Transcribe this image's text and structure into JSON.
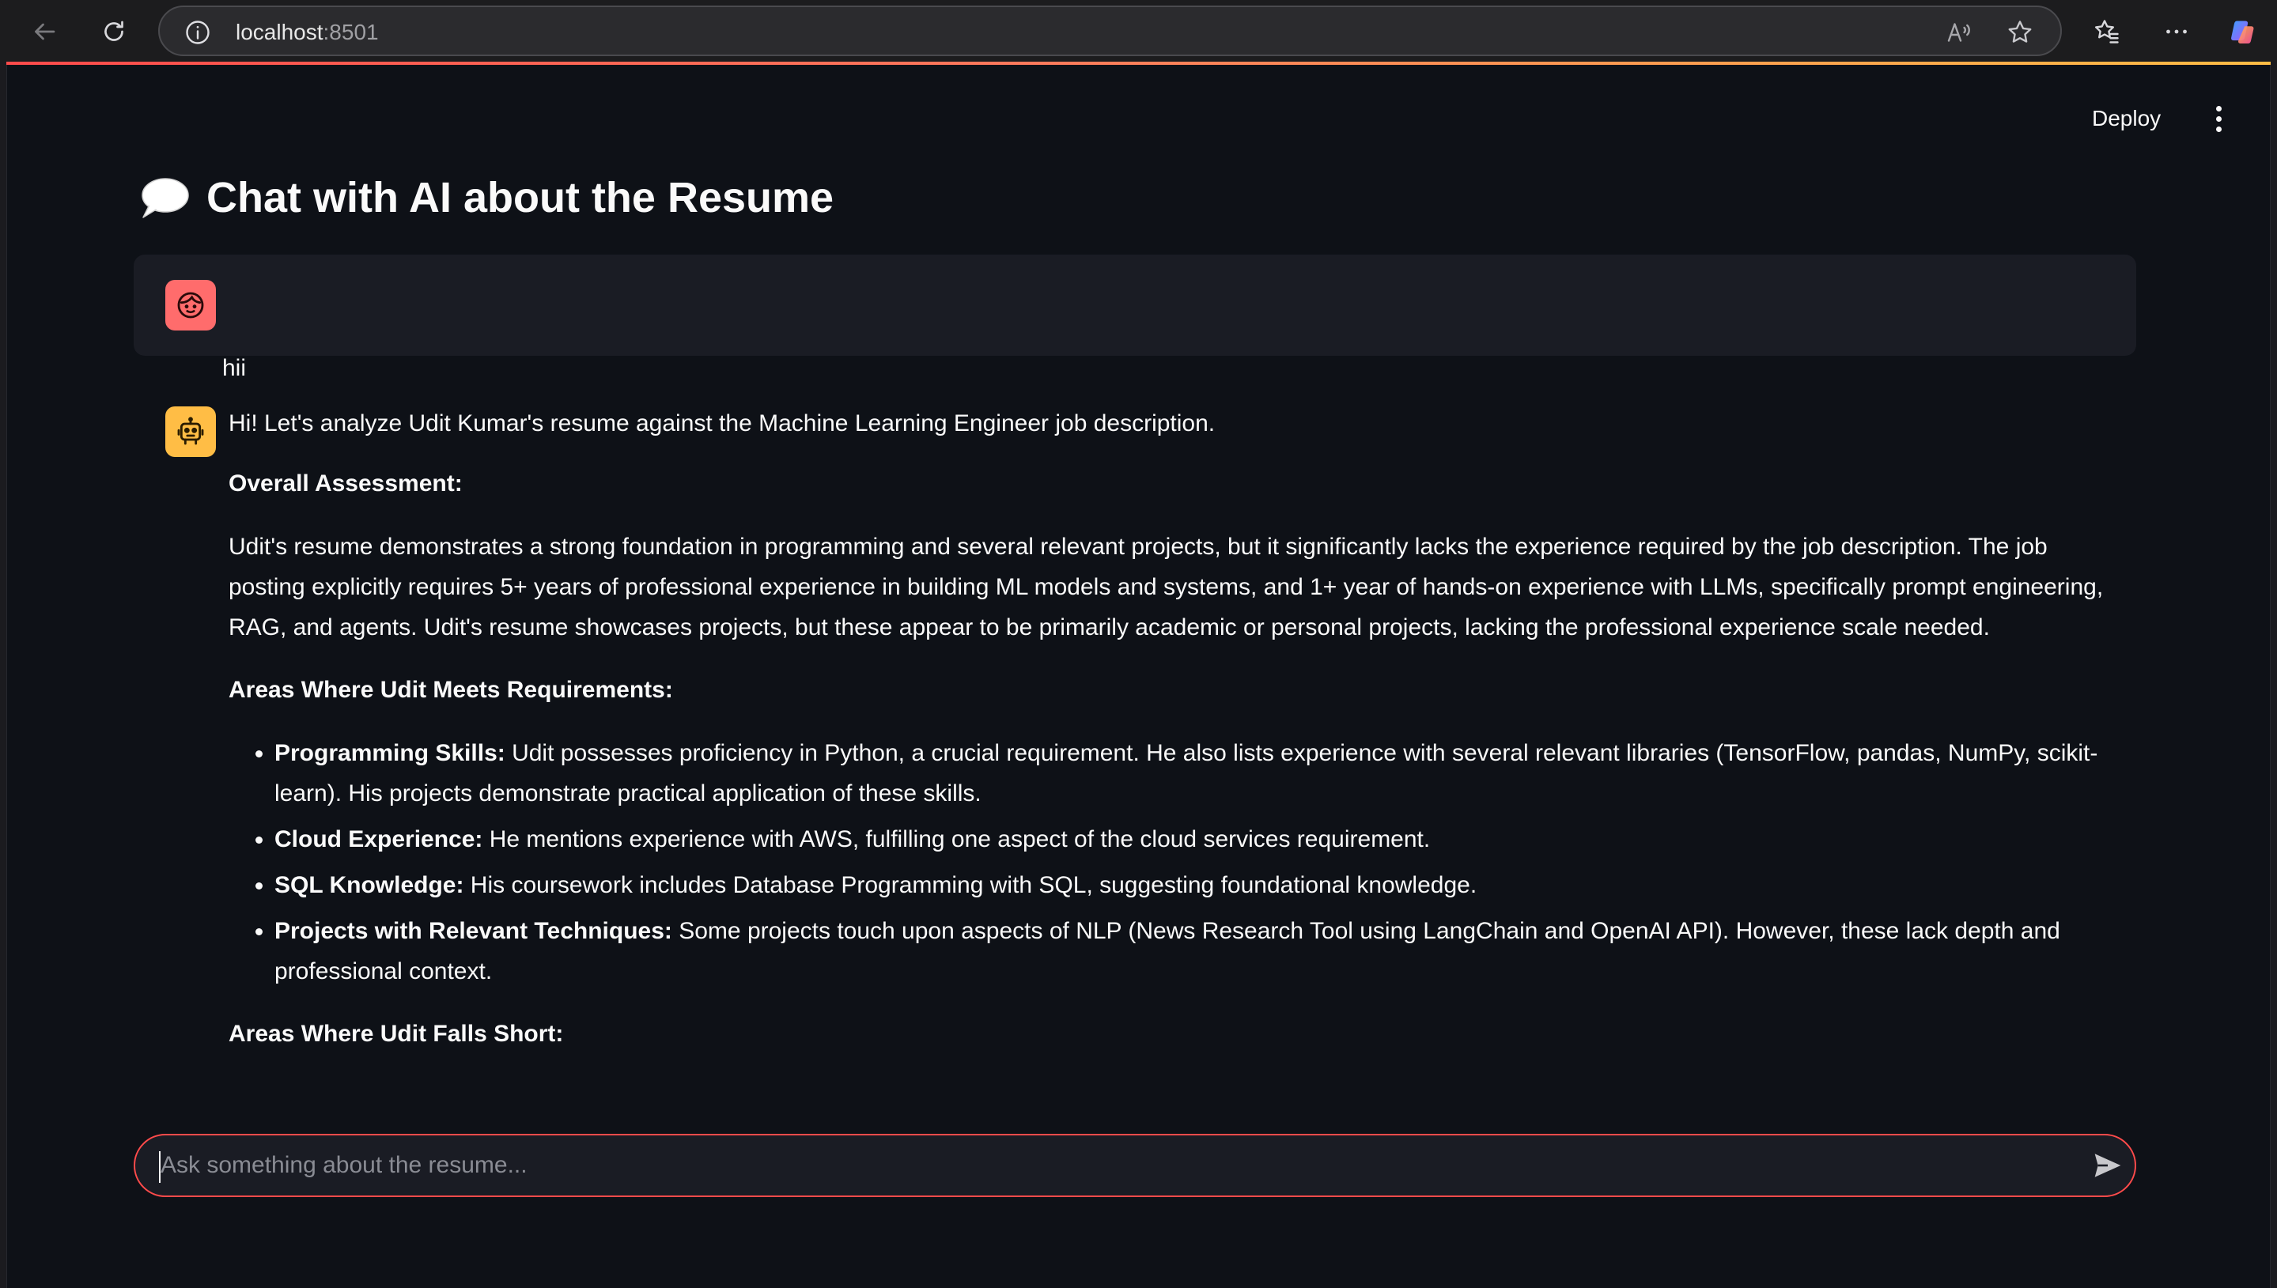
{
  "browser": {
    "url_host": "localhost",
    "url_port": ":8501"
  },
  "header": {
    "deploy_label": "Deploy"
  },
  "page": {
    "title": "Chat with AI about the Resume"
  },
  "chat": {
    "user_message": "hii",
    "assistant": {
      "intro": "Hi! Let's analyze Udit Kumar's resume against the Machine Learning Engineer job description.",
      "heading_overall": "Overall Assessment:",
      "overall_text": "Udit's resume demonstrates a strong foundation in programming and several relevant projects, but it significantly lacks the experience required by the job description. The job posting explicitly requires 5+ years of professional experience in building ML models and systems, and 1+ year of hands-on experience with LLMs, specifically prompt engineering, RAG, and agents. Udit's resume showcases projects, but these appear to be primarily academic or personal projects, lacking the professional experience scale needed.",
      "heading_meets": "Areas Where Udit Meets Requirements:",
      "meets_items": [
        {
          "label": "Programming Skills:",
          "text": " Udit possesses proficiency in Python, a crucial requirement. He also lists experience with several relevant libraries (TensorFlow, pandas, NumPy, scikit-learn). His projects demonstrate practical application of these skills."
        },
        {
          "label": "Cloud Experience:",
          "text": " He mentions experience with AWS, fulfilling one aspect of the cloud services requirement."
        },
        {
          "label": "SQL Knowledge:",
          "text": " His coursework includes Database Programming with SQL, suggesting foundational knowledge."
        },
        {
          "label": "Projects with Relevant Techniques:",
          "text": " Some projects touch upon aspects of NLP (News Research Tool using LangChain and OpenAI API). However, these lack depth and professional context."
        }
      ],
      "heading_short": "Areas Where Udit Falls Short:"
    },
    "input": {
      "placeholder": "Ask something about the resume..."
    }
  },
  "icons": {
    "back": "arrow-left-icon",
    "refresh": "refresh-icon",
    "info": "info-icon",
    "read_aloud": "read-aloud-icon",
    "favorite": "star-icon",
    "favorites": "favorites-icon",
    "more": "more-icon",
    "copilot": "copilot-icon",
    "menu": "vertical-dots-icon",
    "title": "speech-bubble-icon",
    "user_avatar": "face-icon",
    "bot_avatar": "robot-icon",
    "send": "send-icon"
  },
  "colors": {
    "accent": "#ff4b4b",
    "app_background": "#0e1117",
    "user_avatar": "#ff6c6c",
    "bot_avatar": "#ffbd45"
  }
}
